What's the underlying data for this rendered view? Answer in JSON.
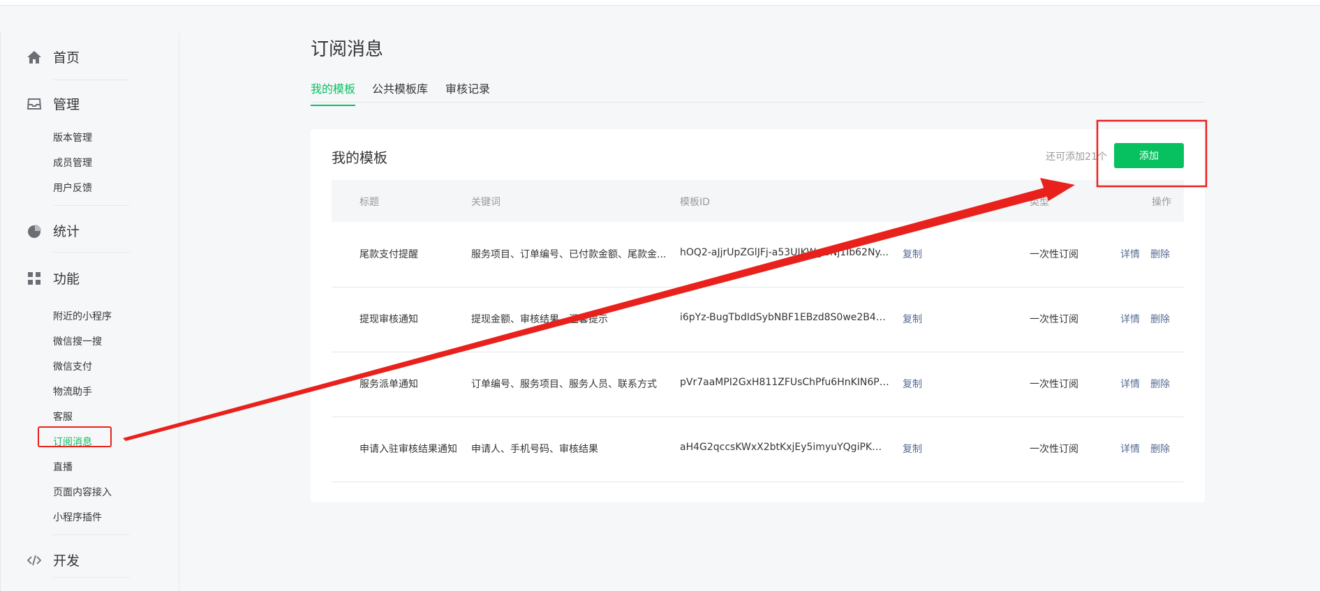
{
  "sidebar": {
    "groups": [
      {
        "label": "首页",
        "icon": "home-icon"
      },
      {
        "label": "管理",
        "icon": "inbox-icon",
        "items": [
          "版本管理",
          "成员管理",
          "用户反馈"
        ]
      },
      {
        "label": "统计",
        "icon": "pie-chart-icon"
      },
      {
        "label": "功能",
        "icon": "grid-icon",
        "items": [
          "附近的小程序",
          "微信搜一搜",
          "微信支付",
          "物流助手",
          "客服",
          "订阅消息",
          "直播",
          "页面内容接入",
          "小程序插件"
        ]
      },
      {
        "label": "开发",
        "icon": "code-icon"
      }
    ],
    "active_item": "订阅消息"
  },
  "page": {
    "title": "订阅消息",
    "tabs": [
      "我的模板",
      "公共模板库",
      "审核记录"
    ],
    "active_tab": "我的模板"
  },
  "card": {
    "title": "我的模板",
    "remaining_text": "还可添加21个",
    "add_label": "添加"
  },
  "table": {
    "headers": [
      "标题",
      "关键词",
      "模板ID",
      "类型",
      "操作"
    ],
    "rows": [
      {
        "title": "尾款支付提醒",
        "keywords": "服务项目、订单编号、已付款金额、尾款金...",
        "template_id": "hOQ2-aJjrUpZGlJFj-a53UJKWgGNj1Ib62Ny...",
        "copy": "复制",
        "type": "一次性订阅",
        "detail": "详情",
        "delete": "删除"
      },
      {
        "title": "提现审核通知",
        "keywords": "提现金额、审核结果、温馨提示",
        "template_id": "i6pYz-BugTbdIdSybNBF1EBzd8S0we2B4w6...",
        "copy": "复制",
        "type": "一次性订阅",
        "detail": "详情",
        "delete": "删除"
      },
      {
        "title": "服务派单通知",
        "keywords": "订单编号、服务项目、服务人员、联系方式",
        "template_id": "pVr7aaMPI2GxH811ZFUsChPfu6HnKIN6Pg...",
        "copy": "复制",
        "type": "一次性订阅",
        "detail": "详情",
        "delete": "删除"
      },
      {
        "title": "申请入驻审核结果通知",
        "keywords": "申请人、手机号码、审核结果",
        "template_id": "aH4G2qccsKWxX2btKxjEy5imyuYQgiPKMp...",
        "copy": "复制",
        "type": "一次性订阅",
        "detail": "详情",
        "delete": "删除"
      }
    ]
  },
  "colors": {
    "accent": "#07c160",
    "link": "#576b95",
    "annotation": "#e8211c"
  }
}
